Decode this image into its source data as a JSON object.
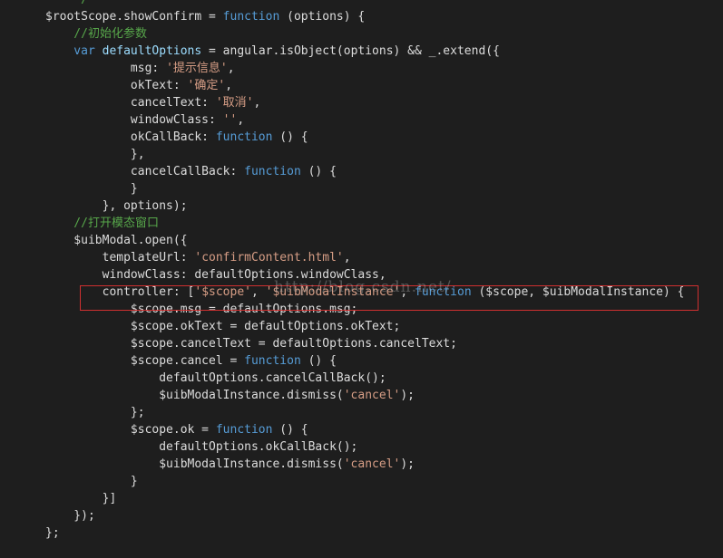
{
  "colors": {
    "background": "#1e1e1e",
    "text": "#dcdcdc",
    "keyword": "#569cd6",
    "string": "#d69d85",
    "comment": "#57a64a",
    "identifier": "#9cdcfe",
    "highlight_border": "#d03030"
  },
  "watermark": "http://blog.csdn.net/",
  "highlighted_line": 17,
  "lines": [
    [
      {
        "t": "cmt",
        "v": "  * */"
      }
    ],
    [
      {
        "t": "text",
        "v": "$rootScope.showConfirm = "
      },
      {
        "t": "kw",
        "v": "function"
      },
      {
        "t": "text",
        "v": " (options) {"
      }
    ],
    [
      {
        "t": "cmt",
        "v": "    //初始化参数"
      }
    ],
    [
      {
        "t": "kw",
        "v": "    var"
      },
      {
        "t": "text",
        "v": " "
      },
      {
        "t": "id",
        "v": "defaultOptions"
      },
      {
        "t": "text",
        "v": " = angular.isObject(options) && _.extend({"
      }
    ],
    [
      {
        "t": "text",
        "v": "            msg: "
      },
      {
        "t": "str",
        "v": "'提示信息'"
      },
      {
        "t": "text",
        "v": ","
      }
    ],
    [
      {
        "t": "text",
        "v": "            okText: "
      },
      {
        "t": "str",
        "v": "'确定'"
      },
      {
        "t": "text",
        "v": ","
      }
    ],
    [
      {
        "t": "text",
        "v": "            cancelText: "
      },
      {
        "t": "str",
        "v": "'取消'"
      },
      {
        "t": "text",
        "v": ","
      }
    ],
    [
      {
        "t": "text",
        "v": "            windowClass: "
      },
      {
        "t": "str",
        "v": "''"
      },
      {
        "t": "text",
        "v": ","
      }
    ],
    [
      {
        "t": "text",
        "v": "            okCallBack: "
      },
      {
        "t": "kw",
        "v": "function"
      },
      {
        "t": "text",
        "v": " () {"
      }
    ],
    [
      {
        "t": "text",
        "v": "            },"
      }
    ],
    [
      {
        "t": "text",
        "v": "            cancelCallBack: "
      },
      {
        "t": "kw",
        "v": "function"
      },
      {
        "t": "text",
        "v": " () {"
      }
    ],
    [
      {
        "t": "text",
        "v": "            }"
      }
    ],
    [
      {
        "t": "text",
        "v": "        }, options);"
      }
    ],
    [
      {
        "t": "cmt",
        "v": "    //打开模态窗口"
      }
    ],
    [
      {
        "t": "text",
        "v": "    $uibModal.open({"
      }
    ],
    [
      {
        "t": "text",
        "v": "        templateUrl: "
      },
      {
        "t": "str",
        "v": "'confirmContent.html'"
      },
      {
        "t": "text",
        "v": ","
      }
    ],
    [
      {
        "t": "text",
        "v": "        windowClass: defaultOptions.windowClass,"
      }
    ],
    [
      {
        "t": "text",
        "v": "        controller: ["
      },
      {
        "t": "str",
        "v": "'$scope'"
      },
      {
        "t": "text",
        "v": ", "
      },
      {
        "t": "str",
        "v": "'$uibModalInstance'"
      },
      {
        "t": "text",
        "v": ", "
      },
      {
        "t": "kw",
        "v": "function"
      },
      {
        "t": "text",
        "v": " ($scope, $uibModalInstance) {"
      }
    ],
    [
      {
        "t": "text",
        "v": "            $scope.msg = defaultOptions.msg;"
      }
    ],
    [
      {
        "t": "text",
        "v": "            $scope.okText = defaultOptions.okText;"
      }
    ],
    [
      {
        "t": "text",
        "v": "            $scope.cancelText = defaultOptions.cancelText;"
      }
    ],
    [
      {
        "t": "text",
        "v": "            $scope.cancel = "
      },
      {
        "t": "kw",
        "v": "function"
      },
      {
        "t": "text",
        "v": " () {"
      }
    ],
    [
      {
        "t": "text",
        "v": "                defaultOptions.cancelCallBack();"
      }
    ],
    [
      {
        "t": "text",
        "v": "                $uibModalInstance.dismiss("
      },
      {
        "t": "str",
        "v": "'cancel'"
      },
      {
        "t": "text",
        "v": ");"
      }
    ],
    [
      {
        "t": "text",
        "v": "            };"
      }
    ],
    [
      {
        "t": "text",
        "v": "            $scope.ok = "
      },
      {
        "t": "kw",
        "v": "function"
      },
      {
        "t": "text",
        "v": " () {"
      }
    ],
    [
      {
        "t": "text",
        "v": "                defaultOptions.okCallBack();"
      }
    ],
    [
      {
        "t": "text",
        "v": "                $uibModalInstance.dismiss("
      },
      {
        "t": "str",
        "v": "'cancel'"
      },
      {
        "t": "text",
        "v": ");"
      }
    ],
    [
      {
        "t": "text",
        "v": "            }"
      }
    ],
    [
      {
        "t": "text",
        "v": "        }]"
      }
    ],
    [
      {
        "t": "text",
        "v": "    });"
      }
    ],
    [
      {
        "t": "text",
        "v": "};"
      }
    ]
  ]
}
